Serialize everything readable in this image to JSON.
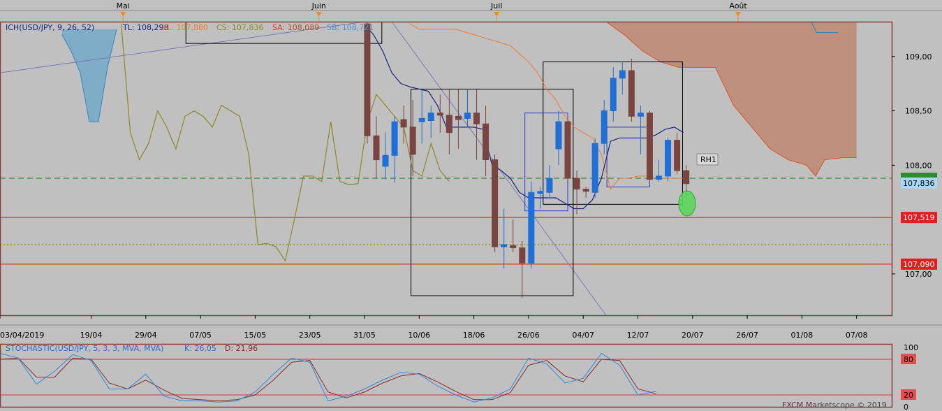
{
  "colors": {
    "background": "#c0c0c0",
    "frame": "#8b3a3a",
    "bull": "#1f6fd6",
    "bear": "#7a4540",
    "tenkan": "#1a237e",
    "kijun": "#f07a30",
    "chikou": "#8a8a2a",
    "cloud_bull": "#6aa6c8",
    "cloud_bear": "#c08068",
    "support": "#e03030",
    "level_green": "#2e8b2e",
    "level_yellow": "#8a8a00",
    "stoch_k": "#2b8ae0",
    "stoch_d": "#8b2a2a"
  },
  "header": {
    "indicator": "ICH(USD/JPY, 9, 26, 52)",
    "tl": "TL: 108,298",
    "kl": "KL: 107,880",
    "cs": "CS: 107,836",
    "sa": "SA: 108,089",
    "sb": "SB: 108,721"
  },
  "months": [
    {
      "label": "Mai",
      "x": 13.5
    },
    {
      "label": "Juin",
      "x": 35
    },
    {
      "label": "Juil",
      "x": 54.5
    },
    {
      "label": "Août",
      "x": 81
    }
  ],
  "price_badges": [
    {
      "label": "107,836",
      "price": 107.836,
      "kind": "current"
    },
    {
      "label": "107,519",
      "price": 107.519,
      "kind": "support"
    },
    {
      "label": "107,090",
      "price": 107.09,
      "kind": "support"
    }
  ],
  "annotation": {
    "label": "RH1"
  },
  "stoch": {
    "label": "STOCHASTIC(USD/JPY, 5, 3, 3, MVA, MVA)",
    "k": "K: 26,05",
    "d": "D: 21,96",
    "axis_labels": [
      "100",
      "80",
      "20",
      "0"
    ]
  },
  "footer": {
    "label": "FXCM Marketscope © 2019"
  },
  "chart_data": {
    "type": "candlestick",
    "x_unit": "trading days (0 = 03/04/2019)",
    "ylim": [
      106.62,
      109.32
    ],
    "y_ticks": [
      {
        "label": "109,00",
        "value": 109.0
      },
      {
        "label": "108,50",
        "value": 108.5
      },
      {
        "label": "108,00",
        "value": 108.0
      },
      {
        "label": "107,00",
        "value": 107.0
      }
    ],
    "x_ticks": [
      {
        "label": "03/04/2019",
        "x": 0
      },
      {
        "label": "19/04",
        "x": 10
      },
      {
        "label": "29/04",
        "x": 16
      },
      {
        "label": "07/05",
        "x": 22
      },
      {
        "label": "15/05",
        "x": 28
      },
      {
        "label": "23/05",
        "x": 34
      },
      {
        "label": "31/05",
        "x": 40
      },
      {
        "label": "10/06",
        "x": 46
      },
      {
        "label": "18/06",
        "x": 52
      },
      {
        "label": "26/06",
        "x": 58
      },
      {
        "label": "04/07",
        "x": 64
      },
      {
        "label": "12/07",
        "x": 70
      },
      {
        "label": "20/07",
        "x": 76
      },
      {
        "label": "26/07",
        "x": 82
      },
      {
        "label": "01/08",
        "x": 88
      },
      {
        "label": "07/08",
        "x": 94
      }
    ],
    "candles": [
      {
        "x": 40.3,
        "o": 109.3,
        "h": 109.32,
        "l": 108.2,
        "c": 108.27
      },
      {
        "x": 41.3,
        "o": 108.27,
        "h": 108.45,
        "l": 107.88,
        "c": 108.05
      },
      {
        "x": 42.3,
        "o": 107.99,
        "h": 108.3,
        "l": 107.87,
        "c": 108.09
      },
      {
        "x": 43.3,
        "o": 108.09,
        "h": 108.45,
        "l": 107.84,
        "c": 108.4
      },
      {
        "x": 44.3,
        "o": 108.42,
        "h": 108.55,
        "l": 108.2,
        "c": 108.35
      },
      {
        "x": 45.3,
        "o": 108.35,
        "h": 108.6,
        "l": 107.9,
        "c": 108.1
      },
      {
        "x": 46.3,
        "o": 108.4,
        "h": 108.7,
        "l": 108.2,
        "c": 108.43
      },
      {
        "x": 47.3,
        "o": 108.41,
        "h": 108.55,
        "l": 108.25,
        "c": 108.48
      },
      {
        "x": 48.3,
        "o": 108.48,
        "h": 108.65,
        "l": 108.3,
        "c": 108.46
      },
      {
        "x": 49.3,
        "o": 108.46,
        "h": 108.7,
        "l": 108.1,
        "c": 108.3
      },
      {
        "x": 50.3,
        "o": 108.45,
        "h": 108.7,
        "l": 108.15,
        "c": 108.42
      },
      {
        "x": 51.3,
        "o": 108.43,
        "h": 108.7,
        "l": 108.35,
        "c": 108.48
      },
      {
        "x": 52.3,
        "o": 108.48,
        "h": 108.7,
        "l": 108.05,
        "c": 108.38
      },
      {
        "x": 53.3,
        "o": 108.38,
        "h": 108.55,
        "l": 107.9,
        "c": 108.05
      },
      {
        "x": 54.3,
        "o": 108.05,
        "h": 108.1,
        "l": 107.2,
        "c": 107.25
      },
      {
        "x": 55.3,
        "o": 107.25,
        "h": 107.6,
        "l": 107.05,
        "c": 107.27
      },
      {
        "x": 56.3,
        "o": 107.26,
        "h": 107.5,
        "l": 107.2,
        "c": 107.24
      },
      {
        "x": 57.3,
        "o": 107.24,
        "h": 107.3,
        "l": 106.78,
        "c": 107.1
      },
      {
        "x": 58.3,
        "o": 107.1,
        "h": 107.85,
        "l": 107.05,
        "c": 107.75
      },
      {
        "x": 59.3,
        "o": 107.74,
        "h": 107.8,
        "l": 107.6,
        "c": 107.76
      },
      {
        "x": 60.3,
        "o": 107.75,
        "h": 108.0,
        "l": 107.7,
        "c": 107.88
      },
      {
        "x": 61.3,
        "o": 108.15,
        "h": 108.5,
        "l": 108.0,
        "c": 108.4
      },
      {
        "x": 62.3,
        "o": 108.4,
        "h": 108.45,
        "l": 107.85,
        "c": 107.88
      },
      {
        "x": 63.3,
        "o": 107.88,
        "h": 107.95,
        "l": 107.55,
        "c": 107.78
      },
      {
        "x": 64.3,
        "o": 107.78,
        "h": 107.8,
        "l": 107.7,
        "c": 107.76
      },
      {
        "x": 65.3,
        "o": 107.75,
        "h": 108.25,
        "l": 107.7,
        "c": 108.2
      },
      {
        "x": 66.3,
        "o": 108.2,
        "h": 108.6,
        "l": 108.1,
        "c": 108.5
      },
      {
        "x": 67.3,
        "o": 108.5,
        "h": 108.9,
        "l": 108.4,
        "c": 108.8
      },
      {
        "x": 68.3,
        "o": 108.8,
        "h": 108.95,
        "l": 108.65,
        "c": 108.87
      },
      {
        "x": 69.3,
        "o": 108.87,
        "h": 108.98,
        "l": 108.4,
        "c": 108.45
      },
      {
        "x": 70.3,
        "o": 108.45,
        "h": 108.55,
        "l": 108.1,
        "c": 108.48
      },
      {
        "x": 71.3,
        "o": 108.48,
        "h": 108.5,
        "l": 107.85,
        "c": 107.87
      },
      {
        "x": 72.3,
        "o": 107.87,
        "h": 108.05,
        "l": 107.85,
        "c": 107.9
      },
      {
        "x": 73.3,
        "o": 107.9,
        "h": 108.25,
        "l": 107.85,
        "c": 108.23
      },
      {
        "x": 74.3,
        "o": 108.23,
        "h": 108.3,
        "l": 107.92,
        "c": 107.95
      },
      {
        "x": 75.3,
        "o": 107.95,
        "h": 108.0,
        "l": 107.68,
        "c": 107.83
      }
    ],
    "tenkan": [
      [
        40,
        109.3
      ],
      [
        41,
        109.2
      ],
      [
        42,
        109.05
      ],
      [
        43,
        108.85
      ],
      [
        44,
        108.75
      ],
      [
        45,
        108.72
      ],
      [
        46,
        108.7
      ],
      [
        47,
        108.68
      ],
      [
        48,
        108.55
      ],
      [
        49,
        108.35
      ],
      [
        50,
        108.35
      ],
      [
        51,
        108.35
      ],
      [
        52,
        108.35
      ],
      [
        53,
        108.33
      ],
      [
        54,
        108.0
      ],
      [
        55,
        107.95
      ],
      [
        56,
        107.88
      ],
      [
        57,
        107.75
      ],
      [
        58,
        107.7
      ],
      [
        59,
        107.7
      ],
      [
        60,
        107.7
      ],
      [
        61,
        107.7
      ],
      [
        62,
        107.65
      ],
      [
        63,
        107.6
      ],
      [
        64,
        107.6
      ],
      [
        65,
        107.68
      ],
      [
        66,
        107.88
      ],
      [
        67,
        108.22
      ],
      [
        68,
        108.25
      ],
      [
        69,
        108.25
      ],
      [
        70,
        108.25
      ],
      [
        71,
        108.25
      ],
      [
        72,
        108.28
      ],
      [
        73,
        108.33
      ],
      [
        74,
        108.35
      ],
      [
        75,
        108.3
      ]
    ],
    "kijun": [
      [
        45,
        109.3
      ],
      [
        46,
        109.25
      ],
      [
        47,
        109.25
      ],
      [
        48,
        109.25
      ],
      [
        50,
        109.25
      ],
      [
        52,
        109.2
      ],
      [
        54,
        109.15
      ],
      [
        56,
        109.1
      ],
      [
        58,
        108.95
      ],
      [
        59,
        108.85
      ],
      [
        60,
        108.7
      ],
      [
        61,
        108.6
      ],
      [
        62,
        108.45
      ],
      [
        63,
        108.35
      ],
      [
        64,
        108.3
      ],
      [
        65,
        108.25
      ],
      [
        66,
        108.1
      ],
      [
        67,
        107.78
      ],
      [
        68,
        107.88
      ],
      [
        69,
        107.88
      ],
      [
        70,
        107.9
      ],
      [
        71,
        107.9
      ],
      [
        72,
        107.88
      ],
      [
        73,
        107.88
      ],
      [
        74,
        107.88
      ],
      [
        75,
        107.88
      ]
    ],
    "chikou": [
      [
        13.3,
        109.3
      ],
      [
        14.3,
        108.3
      ],
      [
        15.3,
        108.05
      ],
      [
        16.3,
        108.2
      ],
      [
        17.3,
        108.5
      ],
      [
        18.3,
        108.35
      ],
      [
        19.3,
        108.15
      ],
      [
        20.3,
        108.45
      ],
      [
        21.3,
        108.5
      ],
      [
        22.3,
        108.45
      ],
      [
        23.3,
        108.35
      ],
      [
        24.3,
        108.55
      ],
      [
        25.3,
        108.5
      ],
      [
        26.3,
        108.45
      ],
      [
        27.3,
        108.1
      ],
      [
        28.3,
        107.27
      ],
      [
        29.3,
        107.28
      ],
      [
        30.3,
        107.25
      ],
      [
        31.3,
        107.12
      ],
      [
        32.3,
        107.5
      ],
      [
        33.3,
        107.9
      ],
      [
        34.3,
        107.9
      ],
      [
        35.3,
        107.85
      ],
      [
        36.3,
        108.4
      ],
      [
        37.3,
        107.85
      ],
      [
        38.3,
        107.82
      ],
      [
        39.3,
        107.83
      ],
      [
        40.3,
        108.4
      ],
      [
        41.3,
        108.65
      ],
      [
        42.3,
        108.55
      ],
      [
        43.3,
        108.45
      ],
      [
        44.3,
        108.35
      ],
      [
        45.3,
        107.95
      ],
      [
        46.3,
        107.9
      ],
      [
        47.3,
        108.2
      ],
      [
        48.3,
        107.95
      ],
      [
        49.3,
        107.85
      ]
    ],
    "cloud_blue": {
      "upper": [
        [
          6.8,
          109.2
        ],
        [
          7.8,
          109.05
        ],
        [
          8.8,
          108.85
        ],
        [
          9.8,
          108.4
        ],
        [
          10.8,
          108.4
        ],
        [
          11.8,
          108.9
        ],
        [
          12.8,
          109.25
        ]
      ],
      "lower": [
        [
          6.8,
          109.25
        ],
        [
          12.8,
          109.25
        ]
      ]
    },
    "cloud_red": {
      "upper": [
        [
          66.5,
          109.32
        ],
        [
          94,
          109.32
        ]
      ],
      "lower": [
        [
          66.5,
          109.32
        ],
        [
          68.5,
          109.2
        ],
        [
          70.5,
          109.05
        ],
        [
          72.5,
          108.95
        ],
        [
          74.5,
          108.9
        ],
        [
          76.5,
          108.9
        ],
        [
          78.5,
          108.9
        ],
        [
          80.5,
          108.55
        ],
        [
          82.5,
          108.35
        ],
        [
          84.5,
          108.15
        ],
        [
          86.5,
          108.05
        ],
        [
          88.5,
          108.0
        ],
        [
          89.5,
          107.9
        ],
        [
          90.5,
          108.05
        ],
        [
          92.5,
          108.07
        ],
        [
          94,
          108.07
        ]
      ]
    },
    "cloud_tail": [
      [
        89,
        109.32
      ],
      [
        89.6,
        109.22
      ],
      [
        92,
        109.22
      ]
    ],
    "trendlines": [
      {
        "x1": 0,
        "y1": 108.85,
        "x2": 40,
        "y2": 109.32,
        "color": "#7a7ab8"
      },
      {
        "x1": 43,
        "y1": 109.32,
        "x2": 66.5,
        "y2": 106.62,
        "color": "#7a7ab8"
      }
    ],
    "levels": [
      {
        "price": 107.88,
        "color": "#2e8b2e",
        "dash": "8,5"
      },
      {
        "price": 107.519,
        "color": "#e03030",
        "dash": ""
      },
      {
        "price": 107.27,
        "color": "#8a8a00",
        "dash": "2,3"
      },
      {
        "price": 107.09,
        "color": "#e03030",
        "dash": ""
      }
    ],
    "boxes": [
      {
        "x1": 20.4,
        "x2": 41.9,
        "y1": 109.12,
        "y2": 109.32,
        "color": "#000000"
      },
      {
        "x1": 45.1,
        "x2": 62.9,
        "y1": 106.8,
        "y2": 108.7,
        "color": "#000000"
      },
      {
        "x1": 59.6,
        "x2": 74.9,
        "y1": 107.64,
        "y2": 108.95,
        "color": "#000000"
      },
      {
        "x1": 57.6,
        "x2": 62.3,
        "y1": 107.58,
        "y2": 108.48,
        "color": "#2a3cc8"
      },
      {
        "x1": 66.6,
        "x2": 71.3,
        "y1": 107.8,
        "y2": 108.35,
        "color": "#2a3cc8"
      }
    ],
    "stoch_k": [
      [
        0,
        90
      ],
      [
        2,
        82
      ],
      [
        4,
        38
      ],
      [
        6,
        60
      ],
      [
        8,
        88
      ],
      [
        10,
        78
      ],
      [
        12,
        30
      ],
      [
        14,
        30
      ],
      [
        16,
        55
      ],
      [
        18,
        18
      ],
      [
        20,
        10
      ],
      [
        22,
        10
      ],
      [
        24,
        8
      ],
      [
        26,
        10
      ],
      [
        28,
        25
      ],
      [
        30,
        55
      ],
      [
        32,
        82
      ],
      [
        34,
        75
      ],
      [
        36,
        10
      ],
      [
        38,
        18
      ],
      [
        40,
        30
      ],
      [
        42,
        45
      ],
      [
        44,
        58
      ],
      [
        46,
        55
      ],
      [
        48,
        35
      ],
      [
        50,
        20
      ],
      [
        52,
        8
      ],
      [
        54,
        15
      ],
      [
        56,
        30
      ],
      [
        58,
        82
      ],
      [
        60,
        72
      ],
      [
        62,
        40
      ],
      [
        64,
        48
      ],
      [
        66,
        90
      ],
      [
        68,
        70
      ],
      [
        70,
        20
      ],
      [
        72,
        26
      ]
    ],
    "stoch_d": [
      [
        0,
        80
      ],
      [
        2,
        82
      ],
      [
        4,
        50
      ],
      [
        6,
        50
      ],
      [
        8,
        82
      ],
      [
        10,
        80
      ],
      [
        12,
        40
      ],
      [
        14,
        30
      ],
      [
        16,
        45
      ],
      [
        18,
        28
      ],
      [
        20,
        14
      ],
      [
        22,
        12
      ],
      [
        24,
        10
      ],
      [
        26,
        12
      ],
      [
        28,
        20
      ],
      [
        30,
        45
      ],
      [
        32,
        75
      ],
      [
        34,
        78
      ],
      [
        36,
        25
      ],
      [
        38,
        15
      ],
      [
        40,
        25
      ],
      [
        42,
        40
      ],
      [
        44,
        52
      ],
      [
        46,
        56
      ],
      [
        48,
        42
      ],
      [
        50,
        26
      ],
      [
        52,
        12
      ],
      [
        54,
        12
      ],
      [
        56,
        24
      ],
      [
        58,
        70
      ],
      [
        60,
        78
      ],
      [
        62,
        52
      ],
      [
        64,
        42
      ],
      [
        66,
        80
      ],
      [
        68,
        78
      ],
      [
        70,
        30
      ],
      [
        72,
        22
      ]
    ],
    "stoch_levels": [
      80,
      20
    ]
  }
}
